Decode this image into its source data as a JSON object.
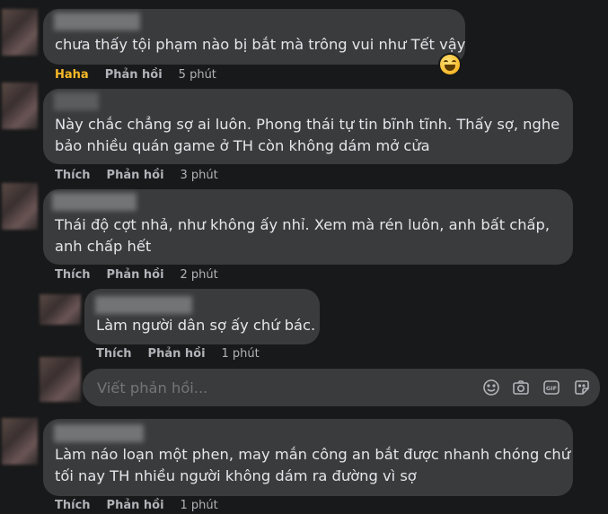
{
  "comments": [
    {
      "text_lines": [
        "chưa thấy tội phạm nào bị bắt mà trông vui như Tết vậy"
      ],
      "reaction_label": "Haha",
      "reply_label": "Phản hồi",
      "time": "5 phút",
      "reaction_icon": "haha-emoji-icon"
    },
    {
      "text_lines": [
        "Này chắc chẳng sợ ai luôn. Phong thái tự tin bĩnh tĩnh. Thấy sợ, nghe",
        "bảo nhiều quán game ở TH còn không dám mở cửa"
      ],
      "like_label": "Thích",
      "reply_label": "Phản hồi",
      "time": "3 phút"
    },
    {
      "text_lines": [
        "Thái độ cợt nhả, như không ấy nhỉ. Xem mà rén luôn, anh bất chấp,",
        "anh chấp hết"
      ],
      "like_label": "Thích",
      "reply_label": "Phản hồi",
      "time": "2 phút"
    },
    {
      "text_lines": [
        "Làm người dân sợ ấy chứ bác."
      ],
      "like_label": "Thích",
      "reply_label": "Phản hồi",
      "time": "1 phút"
    },
    {
      "text_lines": [
        "Làm náo loạn một phen, may mắn công an bắt được nhanh chóng chứ",
        "tối nay TH nhiều người không dám ra đường vì sợ"
      ],
      "like_label": "Thích",
      "reply_label": "Phản hồi",
      "time": "1 phút"
    }
  ],
  "reply_box": {
    "placeholder": "Viết phản hồi...",
    "tools": [
      "emoji-icon",
      "camera-icon",
      "gif-icon",
      "sticker-icon"
    ]
  },
  "colors": {
    "background": "#18191a",
    "bubble": "#3a3b3c",
    "text": "#e4e6eb",
    "secondary": "#b0b3b8",
    "haha": "#f7b928"
  }
}
